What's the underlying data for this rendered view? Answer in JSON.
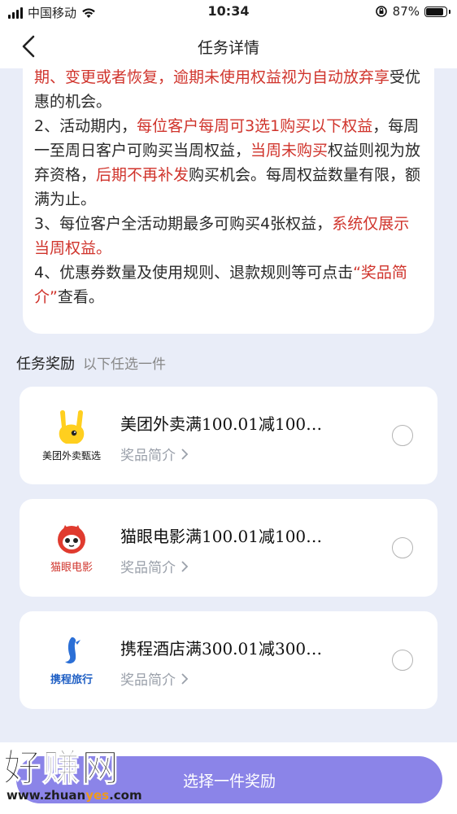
{
  "status_bar": {
    "carrier": "中国移动",
    "time": "10:34",
    "battery_text": "87%",
    "battery_level": 0.87,
    "icons": [
      "signal-icon",
      "wifi-icon",
      "orientation-lock-icon",
      "battery-icon"
    ]
  },
  "nav": {
    "title": "任务详情",
    "back_icon": "chevron-left-icon"
  },
  "rules": {
    "line0": {
      "red": "期、变更或者恢复，逾期未使用权益视为自动放弃享",
      "black": "受优惠的机会。"
    },
    "rule2": {
      "p1": "2、活动期内，",
      "r1": "每位客户每周可3选1购买以下权益",
      "p2": "，每周一至周日客户可购买当周权益，",
      "r2": "当周未购买",
      "p3": "权益则视为放弃资格，",
      "r3": "后期不再补发",
      "p4": "购买机会。每周权益数量有限，额满为止。"
    },
    "rule3": {
      "p1": "3、每位客户全活动期最多可购买4张权益，",
      "r1": "系统仅展示当周权益。"
    },
    "rule4": {
      "p1": "4、优惠券数量及使用规则、退款规则等可点击",
      "r1": "“奖品简介”",
      "p2": "查看。"
    }
  },
  "rewards_section": {
    "title": "任务奖励",
    "subtitle": "以下任选一件"
  },
  "rewards": [
    {
      "logo_caption": "美团外卖甄选",
      "name": "美团外卖满100.01减100…",
      "intro": "奖品简介",
      "logo_icon": "meituan-logo-icon",
      "selected": false
    },
    {
      "logo_caption": "猫眼电影",
      "name": "猫眼电影满100.01减100…",
      "intro": "奖品简介",
      "logo_icon": "maoyan-logo-icon",
      "selected": false
    },
    {
      "logo_caption": "携程旅行",
      "name": "携程酒店满300.01减300…",
      "intro": "奖品简介",
      "logo_icon": "ctrip-logo-icon",
      "selected": false
    }
  ],
  "cta": {
    "label": "选择一件奖励"
  },
  "watermark": {
    "text": "好赚网",
    "url_pre": "www.zhuan",
    "url_y": "yes",
    "url_post": ".com"
  },
  "colors": {
    "accent_red": "#d0342c",
    "cta_purple": "#8b84e8",
    "page_bg": "#e9edf8"
  }
}
